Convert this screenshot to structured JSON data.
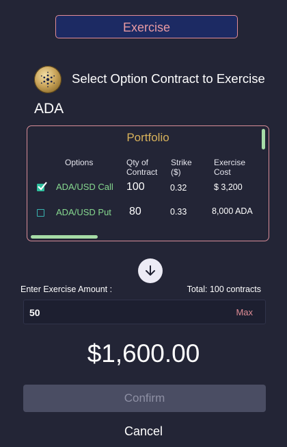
{
  "header": {
    "exercise_label": "Exercise"
  },
  "coin": {
    "icon": "cardano-coin-icon"
  },
  "select_title": "Select Option Contract to Exercise",
  "asset": "ADA",
  "portfolio": {
    "title": "Portfolio",
    "columns": {
      "options": "Options",
      "qty_1": "Qty of",
      "qty_2": "Contract",
      "strike_1": "Strike",
      "strike_2": "($)",
      "cost_1": "Exercise",
      "cost_2": "Cost"
    },
    "rows": [
      {
        "checked": true,
        "option": "ADA/USD Call",
        "qty": "100",
        "strike": "0.32",
        "cost": "$ 3,200"
      },
      {
        "checked": false,
        "option": "ADA/USD Put",
        "qty": "80",
        "strike": "0.33",
        "cost": "8,000 ADA"
      }
    ]
  },
  "amount": {
    "label": "Enter Exercise Amount :",
    "total": "Total: 100 contracts",
    "value": "50",
    "max_label": "Max"
  },
  "total_amount": "$1,600.00",
  "confirm_label": "Confirm",
  "cancel_label": "Cancel",
  "colors": {
    "background": "#232536",
    "accent_pink": "#e38d97",
    "gold": "#d8b25b",
    "green": "#86d88f"
  }
}
